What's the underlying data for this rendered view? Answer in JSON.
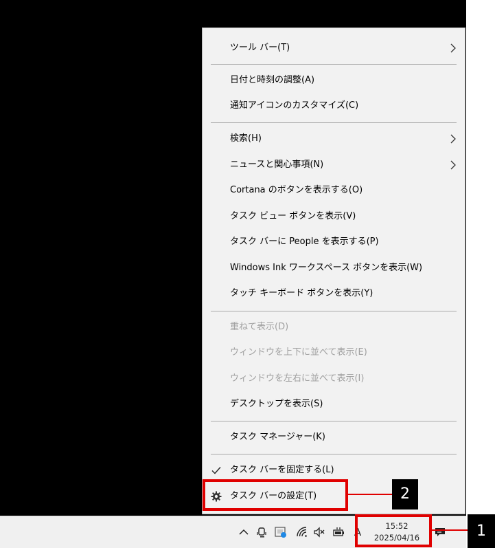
{
  "menu": {
    "items": [
      {
        "label": "ツール バー(T)",
        "submenu": true
      },
      {
        "label": "日付と時刻の調整(A)"
      },
      {
        "label": "通知アイコンのカスタマイズ(C)"
      },
      {
        "label": "検索(H)",
        "submenu": true
      },
      {
        "label": "ニュースと関心事項(N)",
        "submenu": true
      },
      {
        "label": "Cortana のボタンを表示する(O)"
      },
      {
        "label": "タスク ビュー ボタンを表示(V)"
      },
      {
        "label": "タスク バーに People を表示する(P)"
      },
      {
        "label": "Windows Ink ワークスペース ボタンを表示(W)"
      },
      {
        "label": "タッチ キーボード ボタンを表示(Y)"
      },
      {
        "label": "重ねて表示(D)",
        "disabled": true
      },
      {
        "label": "ウィンドウを上下に並べて表示(E)",
        "disabled": true
      },
      {
        "label": "ウィンドウを左右に並べて表示(I)",
        "disabled": true
      },
      {
        "label": "デスクトップを表示(S)"
      },
      {
        "label": "タスク マネージャー(K)"
      },
      {
        "label": "タスク バーを固定する(L)",
        "checked": true
      },
      {
        "label": "タスク バーの設定(T)",
        "icon": "gear-icon"
      }
    ]
  },
  "taskbar": {
    "clock": {
      "time": "15:52",
      "date": "2025/04/16"
    },
    "tray_icons": [
      "chevron-up-icon",
      "meet-now-icon",
      "defender-icon",
      "wifi-icon",
      "muted-speaker-icon",
      "battery-icon",
      "ime-icon",
      "notification-icon"
    ],
    "ime_label": "A"
  },
  "annotations": {
    "callout1": "1",
    "callout2": "2",
    "color": "#e00000"
  }
}
